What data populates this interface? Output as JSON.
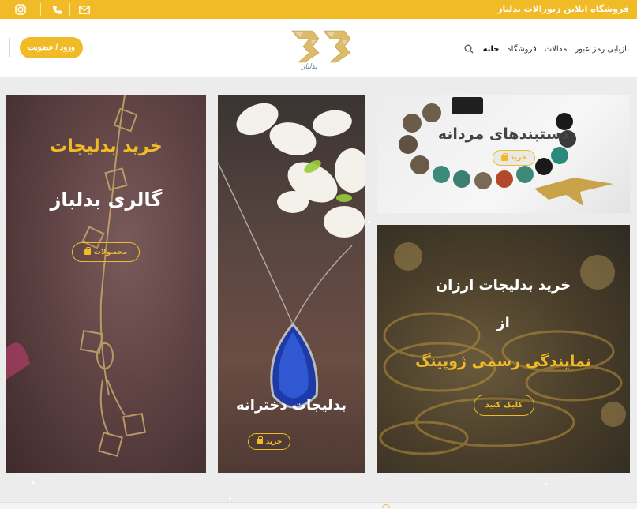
{
  "topbar": {
    "site_text": "فروشگاه انلاین زیورالات بدلباز",
    "instagram_icon": "instagram-icon",
    "phone_icon": "phone-icon",
    "mail_icon": "mail-icon"
  },
  "header": {
    "login_label": "ورود / عضویت",
    "logo_text": "بدلباز",
    "nav": [
      {
        "label": "خانه"
      },
      {
        "label": "فروشگاه"
      },
      {
        "label": "مقالات"
      },
      {
        "label": "بازیابی رمز عبور"
      }
    ]
  },
  "banners": {
    "gallery": {
      "title": "خرید بدلیجات",
      "subtitle": "گالری بدلباز",
      "button": "محصولات"
    },
    "girls": {
      "title": "بدلیجات دخترانه",
      "button": "خرید"
    },
    "mens": {
      "title": "دستبندهای مردانه",
      "button": "خرید"
    },
    "cheap": {
      "line1": "خرید بدلیجات ارزان",
      "line2": "از",
      "line3": "نمایندگی رسمی ژوپینگ",
      "button": "کلیک کنید"
    }
  },
  "colors": {
    "accent": "#f0bb26",
    "topbar": "#f0bb26"
  }
}
